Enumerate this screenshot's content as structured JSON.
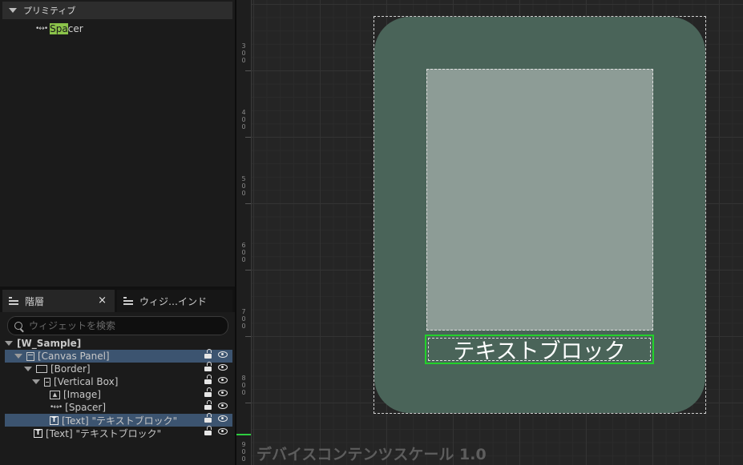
{
  "palette": {
    "category": "プリミティブ",
    "item_highlight": "Spa",
    "item_rest": "cer"
  },
  "hierarchy": {
    "tab_active": "階層",
    "tab_close": "×",
    "tab_inactive": "ウィジ…インド",
    "search_placeholder": "ウィジェットを検索",
    "rows": [
      {
        "label": "[W_Sample]"
      },
      {
        "label": "[Canvas Panel]"
      },
      {
        "label": "[Border]"
      },
      {
        "label": "[Vertical Box]"
      },
      {
        "label": "[Image]"
      },
      {
        "label": "[Spacer]"
      },
      {
        "label": "[Text] \"テキストブロック\""
      },
      {
        "label": "[Text] \"テキストブロック\""
      }
    ]
  },
  "designer": {
    "ruler_ticks": [
      "3\n0\n0",
      "4\n0\n0",
      "5\n0\n0",
      "6\n0\n0",
      "7\n0\n0",
      "8\n0\n0",
      "9\n0\n0"
    ],
    "text_block": "テキストブロック",
    "dpi_scale_label": "デバイスコンテンツスケール 1.0"
  },
  "colors": {
    "border_fill": "#4a6459",
    "image_fill": "#8d9c96",
    "selection_green": "#22d22a",
    "row_selected": "#3c5470",
    "search_highlight": "#8bc34a"
  },
  "icons": [
    "spacer-icon",
    "list-icon",
    "search-icon",
    "canvas-panel-icon",
    "border-icon",
    "vertical-box-icon",
    "image-icon",
    "text-icon",
    "lock-icon",
    "eye-icon"
  ]
}
